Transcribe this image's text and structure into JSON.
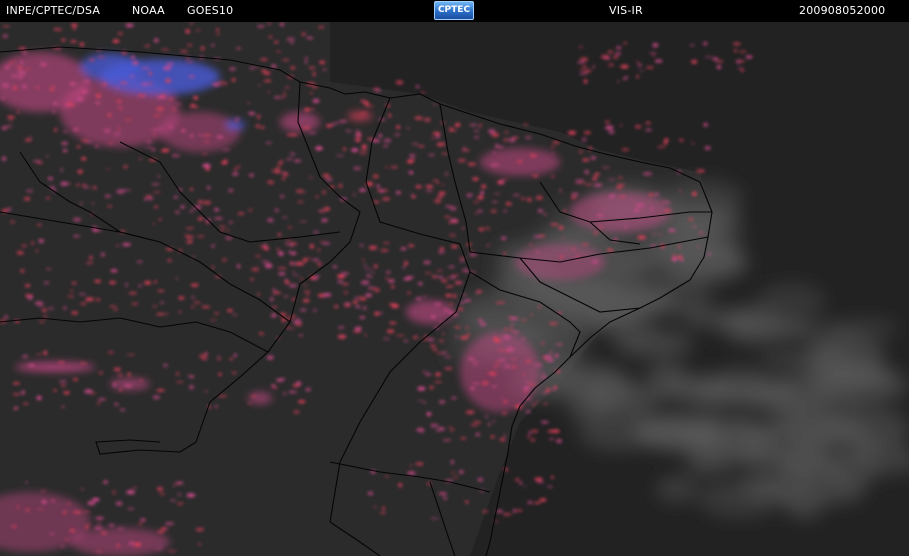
{
  "header": {
    "institution": "INPE/CPTEC/DSA",
    "agency": "NOAA",
    "satellite": "GOES10",
    "logo_text": "CPTEC",
    "channel": "VIS-IR",
    "timestamp": "200908052000"
  },
  "colors": {
    "background": "#2a2a2a",
    "ocean": "#1c1c1c",
    "cloud_pink": "#d14a8c",
    "cloud_red": "#e0405a",
    "cloud_blue": "#4a5bd8",
    "low_cloud_gray": "#5a5a5a",
    "borders": "#000000"
  }
}
